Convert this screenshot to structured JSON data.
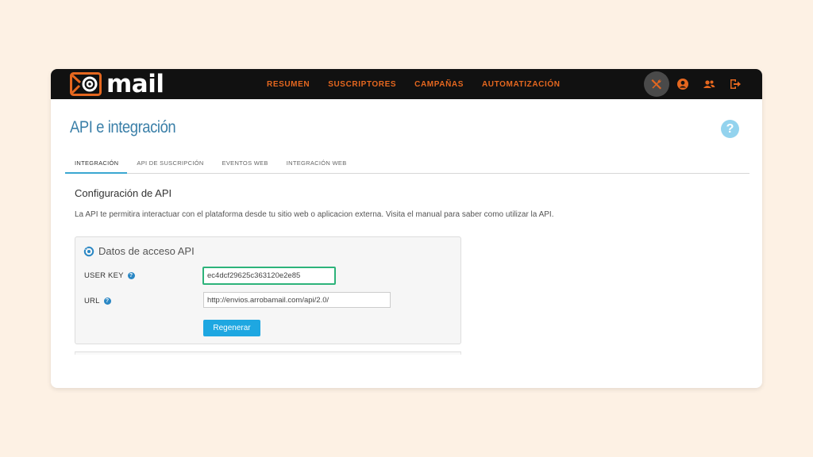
{
  "app": {
    "logo_text": "mail",
    "brand_color": "#e5671f",
    "accent_color": "#1ea7e1"
  },
  "nav": {
    "items": [
      {
        "label": "RESUMEN"
      },
      {
        "label": "SUSCRIPTORES"
      },
      {
        "label": "CAMPAÑAS"
      },
      {
        "label": "AUTOMATIZACIÓN"
      }
    ],
    "icons": [
      "tools-icon",
      "user-icon",
      "users-icon",
      "logout-icon"
    ]
  },
  "page": {
    "title": "API e integración",
    "help_label": "?"
  },
  "tabs": [
    {
      "label": "INTEGRACIÓN",
      "active": true
    },
    {
      "label": "API DE SUSCRIPCIÓN",
      "active": false
    },
    {
      "label": "EVENTOS WEB",
      "active": false
    },
    {
      "label": "INTEGRACIÓN WEB",
      "active": false
    }
  ],
  "config": {
    "title": "Configuración de API",
    "description": "La API te permitira interactuar con el plataforma desde tu sitio web o aplicacion externa. Visita el manual para saber como utilizar la API."
  },
  "panel": {
    "title": "Datos de acceso API",
    "user_key_label": "USER KEY",
    "user_key_value": "ec4dcf29625c363120e2e85",
    "url_label": "URL",
    "url_value": "http://envios.arrobamail.com/api/2.0/",
    "regenerate_label": "Regenerar",
    "help_label": "?"
  }
}
